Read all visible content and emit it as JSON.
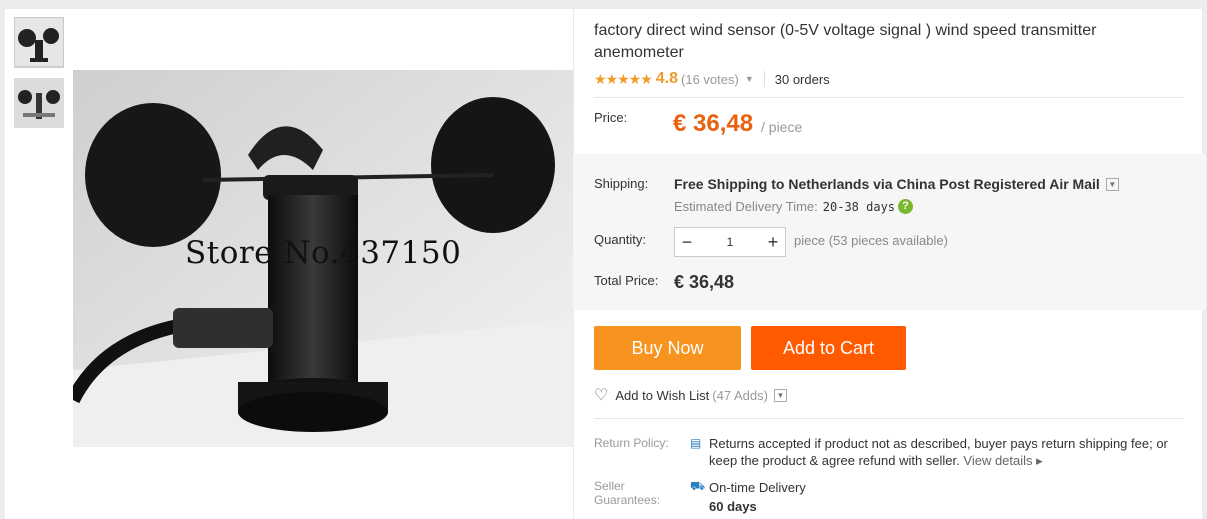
{
  "product": {
    "title": "factory direct wind sensor (0-5V voltage signal ) wind speed transmitter anemometer",
    "watermark": "Store No.437150"
  },
  "rating": {
    "stars": "★★★★★",
    "value": "4.8",
    "votes": "(16 votes)",
    "orders": "30 orders"
  },
  "price": {
    "label": "Price:",
    "value": "€ 36,48",
    "unit": "/ piece"
  },
  "shipping": {
    "label": "Shipping:",
    "text": "Free Shipping to Netherlands via China Post Registered Air Mail",
    "eta_label": "Estimated Delivery Time:",
    "eta_days": "20-38 days"
  },
  "quantity": {
    "label": "Quantity:",
    "value": "1",
    "info": "piece (53 pieces available)",
    "minus": "−",
    "plus": "+"
  },
  "total": {
    "label": "Total Price:",
    "value": "€ 36,48"
  },
  "buttons": {
    "buy_now": "Buy Now",
    "add_to_cart": "Add to Cart"
  },
  "wishlist": {
    "label": "Add to Wish List",
    "adds": "(47 Adds)"
  },
  "return_policy": {
    "label": "Return Policy:",
    "text": "Returns accepted if product not as described, buyer pays return shipping fee; or keep the product & agree refund with seller.",
    "link": "View details"
  },
  "seller": {
    "label": "Seller Guarantees:",
    "guarantee": "On-time Delivery",
    "days": "60 days"
  },
  "colors": {
    "price": "#e8620f",
    "buy_now": "#f7931e",
    "add_to_cart": "#ff5a00",
    "star": "#f19b2b"
  },
  "icons": [
    "heart-icon",
    "help-icon",
    "return-policy-icon",
    "truck-icon",
    "chevron-down-icon"
  ]
}
